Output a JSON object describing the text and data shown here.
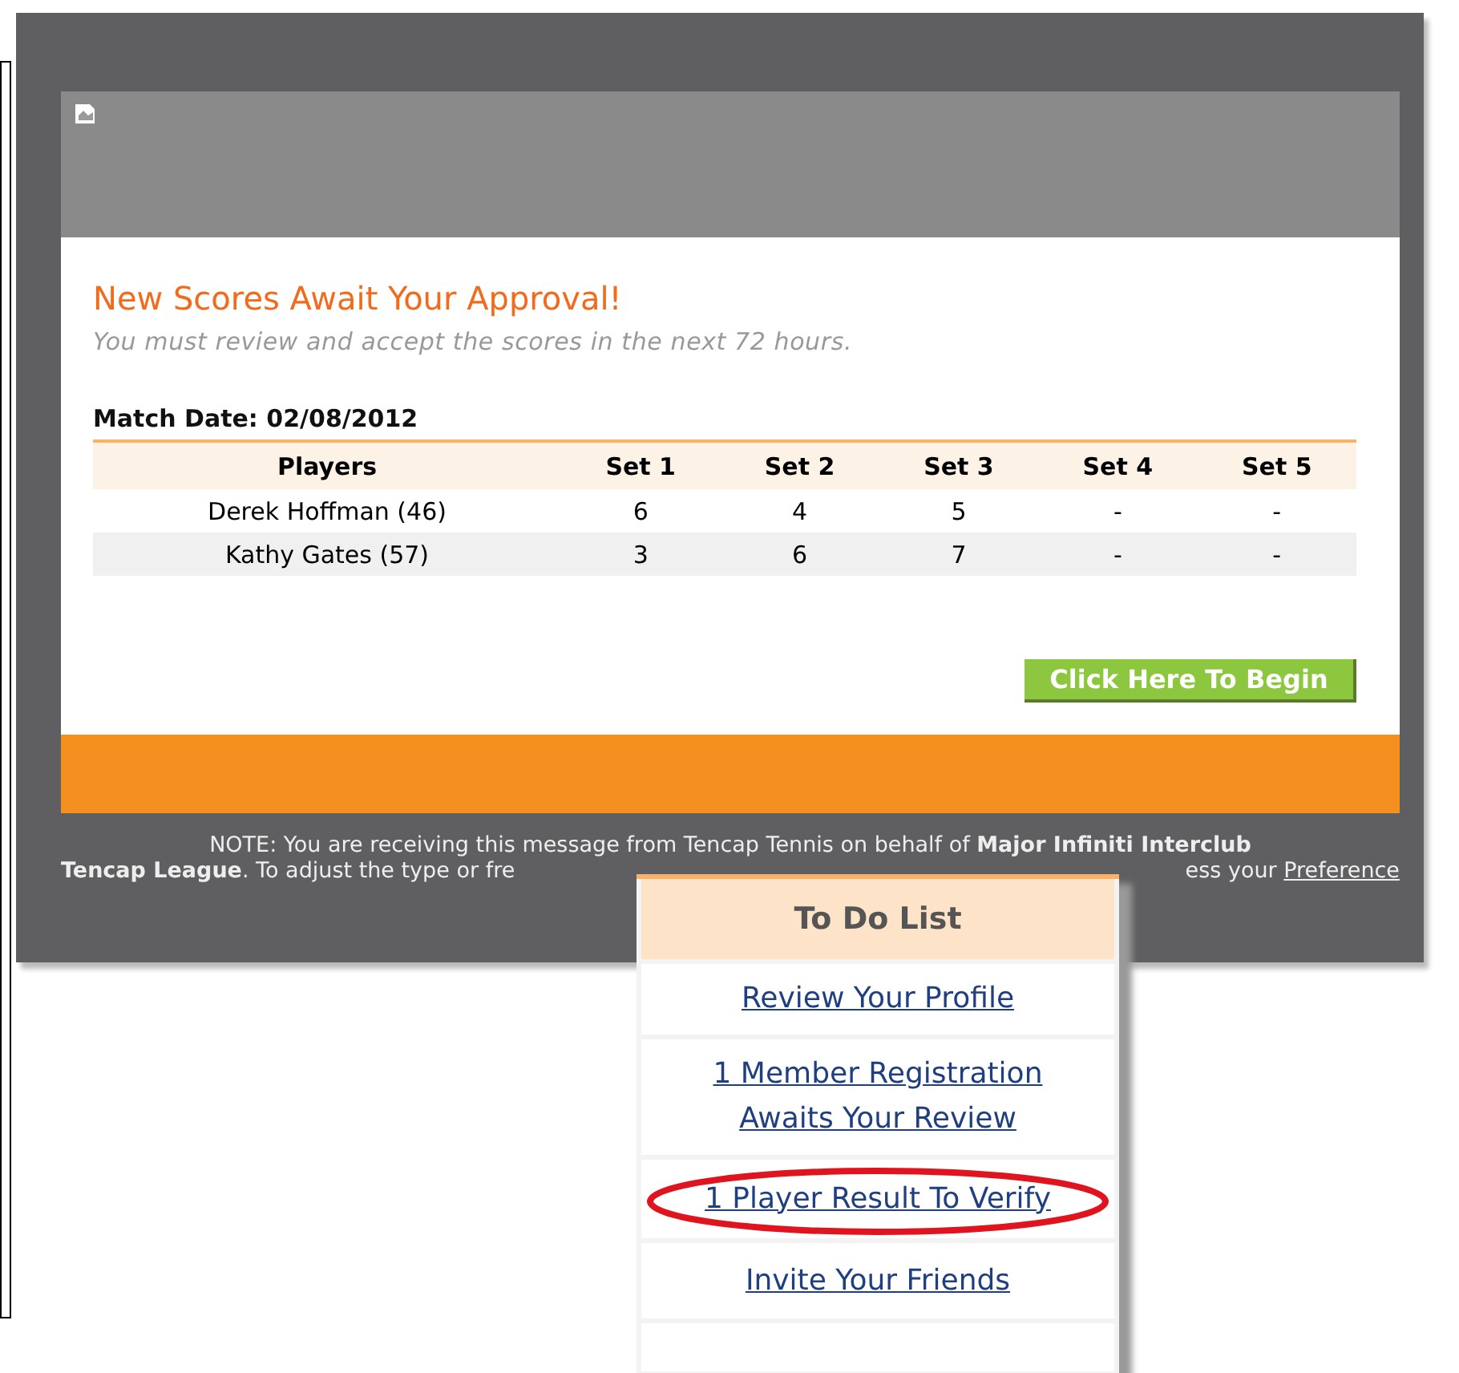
{
  "email": {
    "title": "New Scores Await Your Approval!",
    "subtitle": "You must review and accept the scores in the next 72 hours.",
    "match_date": "Match Date: 02/08/2012",
    "table": {
      "columns": [
        "Players",
        "Set 1",
        "Set 2",
        "Set 3",
        "Set 4",
        "Set 5"
      ],
      "rows": [
        [
          "Derek Hoffman (46)",
          "6",
          "4",
          "5",
          "-",
          "-"
        ],
        [
          "Kathy Gates (57)",
          "3",
          "6",
          "7",
          "-",
          "-"
        ]
      ]
    },
    "button": "Click Here To Begin",
    "note": {
      "line_1": "NOTE: You are receiving this message from Tencap Tennis on behalf of **Major Infiniti Interclub**",
      "line_2_start": "**Tencap League**. To adjust the type or fre",
      "line_2_end": "ess your",
      "link": "Preference"
    }
  },
  "todo": {
    "title": "To Do List",
    "items": [
      {
        "label": "Review Your Profile",
        "highlighted": false
      },
      {
        "label": "1 Member Registration Awaits Your Review",
        "highlighted": false
      },
      {
        "label": "1 Player Result To Verify",
        "highlighted": true
      },
      {
        "label": "Invite Your Friends",
        "highlighted": false
      }
    ]
  }
}
